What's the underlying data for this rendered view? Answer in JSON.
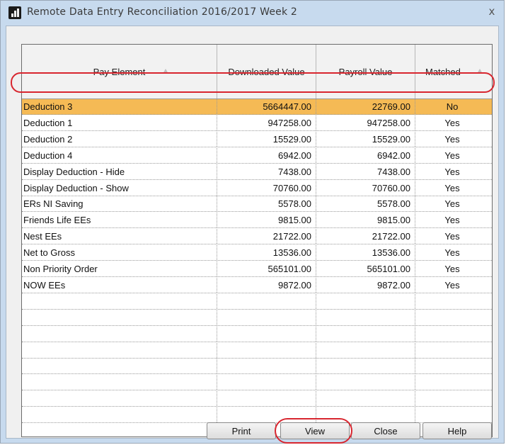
{
  "window": {
    "title": "Remote Data Entry Reconciliation 2016/2017 Week 2",
    "close_glyph": "x"
  },
  "table": {
    "columns": [
      "Pay Element",
      "Downloaded Value",
      "Payroll Value",
      "Matched"
    ],
    "rows": [
      {
        "pay_element": "Deduction 3",
        "downloaded": "5664447.00",
        "payroll": "22769.00",
        "matched": "No",
        "selected": true
      },
      {
        "pay_element": "Deduction 1",
        "downloaded": "947258.00",
        "payroll": "947258.00",
        "matched": "Yes"
      },
      {
        "pay_element": "Deduction 2",
        "downloaded": "15529.00",
        "payroll": "15529.00",
        "matched": "Yes"
      },
      {
        "pay_element": "Deduction 4",
        "downloaded": "6942.00",
        "payroll": "6942.00",
        "matched": "Yes"
      },
      {
        "pay_element": "Display Deduction - Hide",
        "downloaded": "7438.00",
        "payroll": "7438.00",
        "matched": "Yes"
      },
      {
        "pay_element": "Display Deduction - Show",
        "downloaded": "70760.00",
        "payroll": "70760.00",
        "matched": "Yes"
      },
      {
        "pay_element": "ERs NI Saving",
        "downloaded": "5578.00",
        "payroll": "5578.00",
        "matched": "Yes"
      },
      {
        "pay_element": "Friends Life EEs",
        "downloaded": "9815.00",
        "payroll": "9815.00",
        "matched": "Yes"
      },
      {
        "pay_element": "Nest EEs",
        "downloaded": "21722.00",
        "payroll": "21722.00",
        "matched": "Yes"
      },
      {
        "pay_element": "Net to Gross",
        "downloaded": "13536.00",
        "payroll": "13536.00",
        "matched": "Yes"
      },
      {
        "pay_element": "Non Priority Order",
        "downloaded": "565101.00",
        "payroll": "565101.00",
        "matched": "Yes"
      },
      {
        "pay_element": "NOW EEs",
        "downloaded": "9872.00",
        "payroll": "9872.00",
        "matched": "Yes"
      }
    ],
    "empty_rows": 9
  },
  "buttons": {
    "print": "Print",
    "view": "View",
    "close": "Close",
    "help": "Help"
  },
  "colors": {
    "selected_row": "#f5ba55",
    "highlight_ring": "#d8262f",
    "title_bar": "#c7daee"
  }
}
